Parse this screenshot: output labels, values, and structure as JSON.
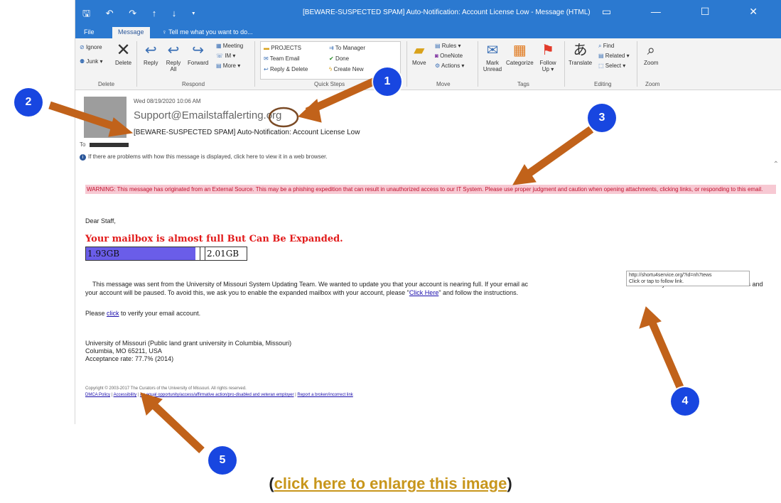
{
  "window": {
    "quick_access": "🖫 ↶ ↷ ↑ ↓ ▾",
    "title": "[BEWARE-SUSPECTED SPAM] Auto-Notification: Account License Low - Message (HTML)",
    "controls": "▭ — ☐ ✕"
  },
  "tabs": {
    "file": "File",
    "message": "Message",
    "tell_me": "♀ Tell me what you want to do..."
  },
  "ribbon": {
    "delete_group": {
      "ignore": "Ignore",
      "junk": "Junk ▾",
      "delete": "Delete",
      "label": "Delete"
    },
    "respond_group": {
      "reply": "Reply",
      "reply_all": "Reply All",
      "forward": "Forward",
      "meeting": "Meeting",
      "im": "IM ▾",
      "more": "More ▾",
      "label": "Respond"
    },
    "quick_steps": {
      "projects": "PROJECTS",
      "team_email": "Team Email",
      "reply_delete": "Reply & Delete",
      "to_manager": "To Manager",
      "done": "Done",
      "create_new": "Create New",
      "label": "Quick Steps"
    },
    "move_group": {
      "move": "Move",
      "rules": "Rules ▾",
      "onenote": "OneNote",
      "actions": "Actions ▾",
      "label": "Move"
    },
    "tags_group": {
      "mark_unread": "Mark Unread",
      "categorize": "Categorize",
      "follow_up": "Follow Up ▾",
      "label": "Tags"
    },
    "editing_group": {
      "translate": "Translate",
      "find": "Find",
      "related": "Related ▾",
      "select": "Select ▾",
      "label": "Editing"
    },
    "zoom_group": {
      "zoom": "Zoom",
      "label": "Zoom"
    }
  },
  "email": {
    "date": "Wed 08/19/2020 10:06 AM",
    "from": "Support@Emailstaffalerting.org",
    "subject": "[BEWARE-SUSPECTED SPAM] Auto-Notification: Account License Low",
    "to_label": "To",
    "info_bar": "If there are problems with how this message is displayed, click here to view it in a web browser.",
    "warning": "WARNING: This message has originated from an External Source. This may be a phishing expedition that can result in unauthorized access to our IT System. Please use proper judgment and caution when opening attachments, clicking links, or responding to this email.",
    "greeting": "Dear Staff,",
    "headline": "Your mailbox is almost full But Can Be Expanded.",
    "quota_used": "1.93GB",
    "quota_total": "2.01GB",
    "quota_fraction": 0.96,
    "para_part1": "This message was sent from the University of Missouri System Updating Team. We wanted to update you that your account is nearing full. If your email ac",
    "para_part2": "size you can not access new emails and your account will be paused. To avoid this, we ask you to enable the expanded mailbox with your account, please \"",
    "para_link": "Click Here",
    "para_part3": "\" and follow the instructions.",
    "verify_prefix": "Please ",
    "verify_link": "click",
    "verify_suffix": " to verify your email account.",
    "address_line1": "University of Missouri (Public land grant university in Columbia, Missouri)",
    "address_line2": "Columbia, MO 65211, USA",
    "address_line3": "Acceptance rate: 77.7% (2014)",
    "copyright": "Copyright © 2003-2017 The Curators of the University of Missouri. All rights reserved.",
    "footer_link1": "DMCA Policy",
    "footer_link2": "Accessibility",
    "footer_link3": "An equal opportunity/access/affirmative action/pro-disabled and veteran employer",
    "footer_link4": "Report a broken/incorrect link",
    "tooltip_url": "http://shortu4service.org/?id=nh7tews",
    "tooltip_hint": "Click or tap to follow link."
  },
  "callouts": [
    "1",
    "2",
    "3",
    "4",
    "5"
  ],
  "caption": {
    "open": "(",
    "link": "click here to enlarge this image",
    "close": ")"
  },
  "colors": {
    "titlebar": "#2b79d0",
    "callout": "#1846e0",
    "arrow": "#c1621a",
    "warning_bg": "#f7c9d3",
    "quota_fill": "#6a5de9"
  }
}
